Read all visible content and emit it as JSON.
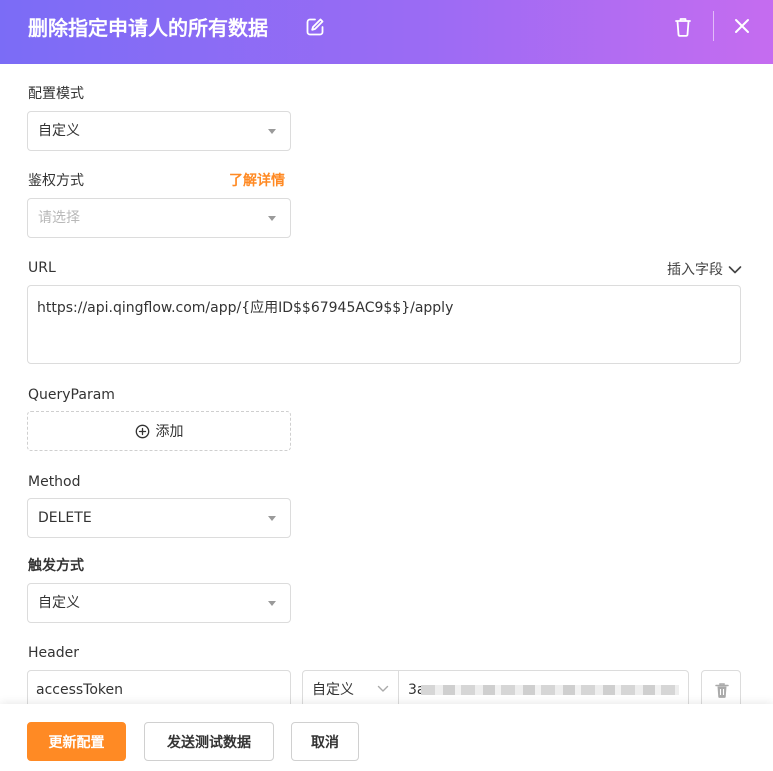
{
  "header": {
    "title": "删除指定申请人的所有数据"
  },
  "form": {
    "config_mode": {
      "label": "配置模式",
      "value": "自定义"
    },
    "auth_method": {
      "label": "鉴权方式",
      "placeholder": "请选择",
      "learn_more": "了解详情"
    },
    "url": {
      "label": "URL",
      "insert_field": "插入字段",
      "value": "https://api.qingflow.com/app/{应用ID$$67945AC9$$}/apply"
    },
    "query_param": {
      "label": "QueryParam",
      "add_label": "添加"
    },
    "method": {
      "label": "Method",
      "value": "DELETE"
    },
    "trigger_method": {
      "label": "触发方式",
      "value": "自定义"
    },
    "header": {
      "label": "Header",
      "key": "accessToken",
      "type": "自定义",
      "value_prefix": "3a"
    }
  },
  "footer": {
    "update_label": "更新配置",
    "send_test_label": "发送测试数据",
    "cancel_label": "取消"
  },
  "colors": {
    "header_gradient_start": "#7b6cf6",
    "header_gradient_end": "#c56cf0",
    "accent_orange": "#ff8a24"
  },
  "icons": [
    "edit-icon",
    "trash-icon",
    "close-icon",
    "caret-down-icon",
    "chevron-down-icon",
    "plus-circle-icon"
  ]
}
